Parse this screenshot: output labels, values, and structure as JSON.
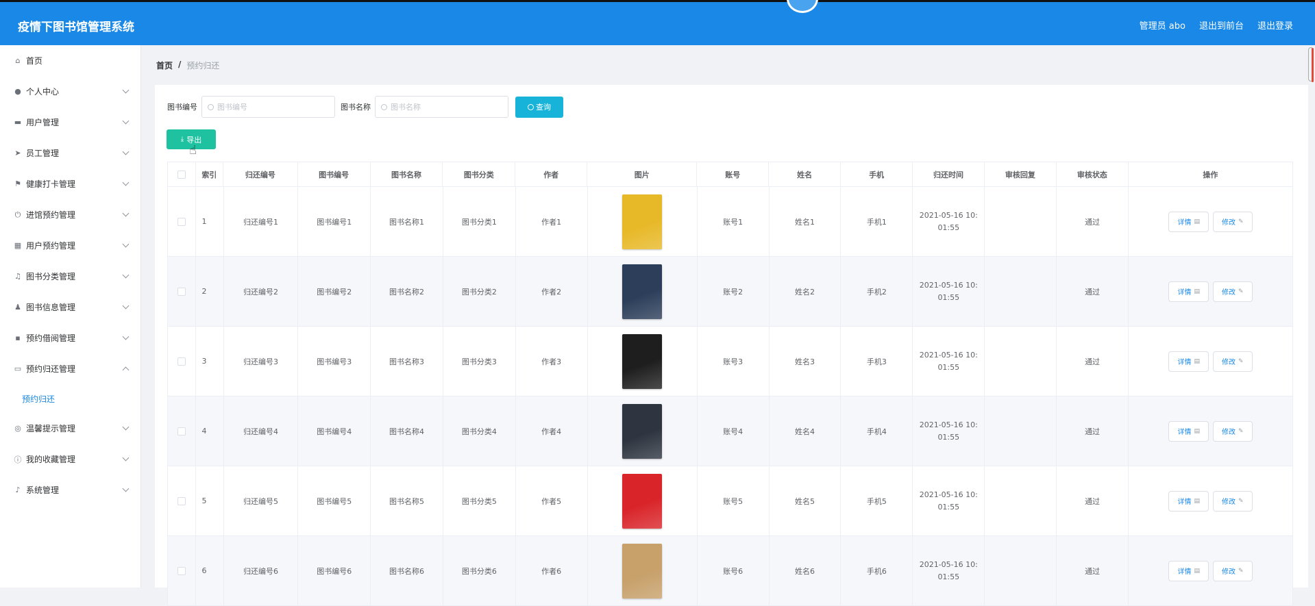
{
  "app": {
    "title": "疫情下图书馆管理系统"
  },
  "topbar": {
    "admin": "管理员 abo",
    "front": "退出到前台",
    "logout": "退出登录"
  },
  "sidebar": {
    "items": [
      {
        "label": "首页",
        "icon": "home-icon",
        "glyph": "⌂",
        "expandable": false
      },
      {
        "label": "个人中心",
        "icon": "user-icon",
        "glyph": "●",
        "expandable": true
      },
      {
        "label": "用户管理",
        "icon": "ticket-icon",
        "glyph": "▬",
        "expandable": true
      },
      {
        "label": "员工管理",
        "icon": "send-icon",
        "glyph": "➤",
        "expandable": true
      },
      {
        "label": "健康打卡管理",
        "icon": "flag-icon",
        "glyph": "⚑",
        "expandable": true
      },
      {
        "label": "进馆预约管理",
        "icon": "power-icon",
        "glyph": "⏻",
        "expandable": true
      },
      {
        "label": "用户预约管理",
        "icon": "grid-icon",
        "glyph": "▦",
        "expandable": true
      },
      {
        "label": "图书分类管理",
        "icon": "bell-off-icon",
        "glyph": "♫",
        "expandable": true
      },
      {
        "label": "图书信息管理",
        "icon": "person-icon",
        "glyph": "♟",
        "expandable": true
      },
      {
        "label": "预约借阅管理",
        "icon": "apps-icon",
        "glyph": "▪",
        "expandable": true
      },
      {
        "label": "预约归还管理",
        "icon": "chat-icon",
        "glyph": "▭",
        "expandable": true,
        "open": true,
        "sub": "预约归还"
      },
      {
        "label": "温馨提示管理",
        "icon": "basketball-icon",
        "glyph": "◎",
        "expandable": true
      },
      {
        "label": "我的收藏管理",
        "icon": "info-icon",
        "glyph": "ⓘ",
        "expandable": true
      },
      {
        "label": "系统管理",
        "icon": "mic-icon",
        "glyph": "♪",
        "expandable": true
      }
    ]
  },
  "breadcrumb": {
    "home": "首页",
    "sep": "/",
    "current": "预约归还"
  },
  "search": {
    "field1_label": "图书编号",
    "field1_placeholder": "图书编号",
    "field2_label": "图书名称",
    "field2_placeholder": "图书名称",
    "query_label": "查询"
  },
  "export_label": "导出",
  "table": {
    "columns": [
      "",
      "索引",
      "归还编号",
      "图书编号",
      "图书名称",
      "图书分类",
      "作者",
      "图片",
      "账号",
      "姓名",
      "手机",
      "归还时间",
      "审核回复",
      "审核状态",
      "操作"
    ],
    "detail_label": "详情",
    "edit_label": "修改",
    "rows": [
      {
        "idx": "1",
        "return_no": "归还编号1",
        "book_no": "图书编号1",
        "book_name": "图书名称1",
        "category": "图书分类1",
        "author": "作者1",
        "cover": "#e7b827",
        "account": "账号1",
        "name": "姓名1",
        "phone": "手机1",
        "time": "2021-05-16 10:\n01:55",
        "reply": "",
        "status": "通过"
      },
      {
        "idx": "2",
        "return_no": "归还编号2",
        "book_no": "图书编号2",
        "book_name": "图书名称2",
        "category": "图书分类2",
        "author": "作者2",
        "cover": "#2c3e5a",
        "account": "账号2",
        "name": "姓名2",
        "phone": "手机2",
        "time": "2021-05-16 10:\n01:55",
        "reply": "",
        "status": "通过"
      },
      {
        "idx": "3",
        "return_no": "归还编号3",
        "book_no": "图书编号3",
        "book_name": "图书名称3",
        "category": "图书分类3",
        "author": "作者3",
        "cover": "#1e1e1e",
        "account": "账号3",
        "name": "姓名3",
        "phone": "手机3",
        "time": "2021-05-16 10:\n01:55",
        "reply": "",
        "status": "通过"
      },
      {
        "idx": "4",
        "return_no": "归还编号4",
        "book_no": "图书编号4",
        "book_name": "图书名称4",
        "category": "图书分类4",
        "author": "作者4",
        "cover": "#2e3540",
        "account": "账号4",
        "name": "姓名4",
        "phone": "手机4",
        "time": "2021-05-16 10:\n01:55",
        "reply": "",
        "status": "通过"
      },
      {
        "idx": "5",
        "return_no": "归还编号5",
        "book_no": "图书编号5",
        "book_name": "图书名称5",
        "category": "图书分类5",
        "author": "作者5",
        "cover": "#d9252a",
        "account": "账号5",
        "name": "姓名5",
        "phone": "手机5",
        "time": "2021-05-16 10:\n01:55",
        "reply": "",
        "status": "通过"
      },
      {
        "idx": "6",
        "return_no": "归还编号6",
        "book_no": "图书编号6",
        "book_name": "图书名称6",
        "category": "图书分类6",
        "author": "作者6",
        "cover": "#c7a06a",
        "account": "账号6",
        "name": "姓名6",
        "phone": "手机6",
        "time": "2021-05-16 10:\n01:55",
        "reply": "",
        "status": "通过"
      }
    ]
  },
  "colors": {
    "brand": "#1a88e6",
    "query": "#17b3d8",
    "export": "#1fc2a0"
  }
}
